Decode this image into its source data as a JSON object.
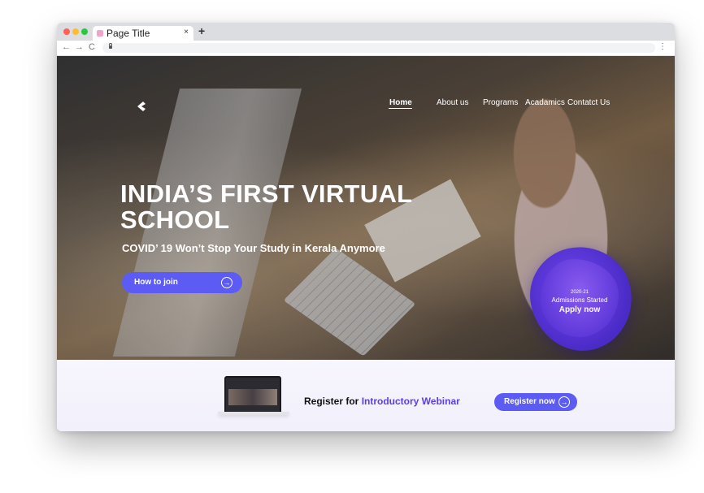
{
  "browser": {
    "tab_title": "Page Title",
    "tab_close": "×",
    "new_tab": "+",
    "nav_back": "←",
    "nav_forward": "→",
    "nav_reload": "C",
    "menu": "⋮"
  },
  "site": {
    "nav": {
      "home": "Home",
      "about": "About us",
      "programs": "Programs",
      "academics": "Acadamics",
      "contact": "Contatct Us"
    },
    "hero": {
      "title_line1": "INDIA’S FIRST VIRTUAL",
      "title_line2": "SCHOOL",
      "subtitle": "COVID’ 19 Won’t Stop Your Study in Kerala Anymore",
      "cta_label": "How to join",
      "cta_arrow": "→"
    },
    "badge": {
      "year": "2020-21",
      "line": "Admissions Started",
      "action": "Apply now"
    },
    "webinar": {
      "text_prefix": "Register for ",
      "text_highlight": "Introductory Webinar",
      "button_label": "Register now",
      "button_arrow": "→"
    }
  },
  "colors": {
    "accent": "#5c5cf4",
    "highlight": "#5a3ee6",
    "badge": "#6a44e6"
  }
}
